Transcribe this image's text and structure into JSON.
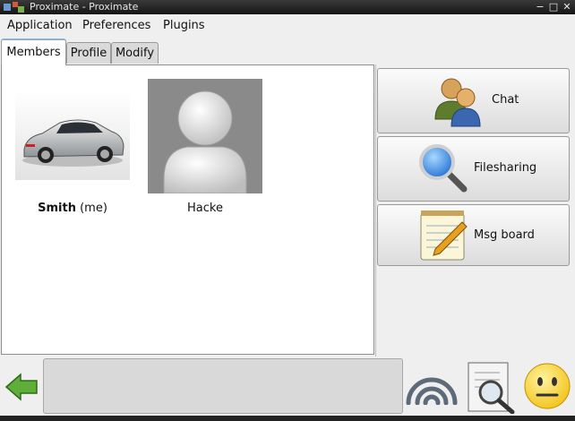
{
  "window": {
    "title": "Proximate - Proximate"
  },
  "menu": {
    "items": [
      "Application",
      "Preferences",
      "Plugins"
    ]
  },
  "tabs": [
    "Members",
    "Profile",
    "Modify"
  ],
  "active_tab": "Members",
  "members": [
    {
      "name": "Smith",
      "suffix": " (me)",
      "avatar": "car-photo"
    },
    {
      "name": "Hacke",
      "suffix": "",
      "avatar": "default-person-silhouette"
    }
  ],
  "side_buttons": [
    {
      "label": "Chat",
      "icon": "people-icon"
    },
    {
      "label": "Filesharing",
      "icon": "magnifier-icon"
    },
    {
      "label": "Msg board",
      "icon": "notepad-pencil-icon"
    }
  ],
  "bottom": {
    "icons": [
      "back-arrow-icon",
      "wireless-signal-icon",
      "document-search-icon",
      "smiley-status-icon"
    ],
    "message_text": ""
  },
  "colors": {
    "accent": "#8ab0d8",
    "arrow_green": "#5fae3a",
    "smiley_yellow": "#f2c318"
  }
}
